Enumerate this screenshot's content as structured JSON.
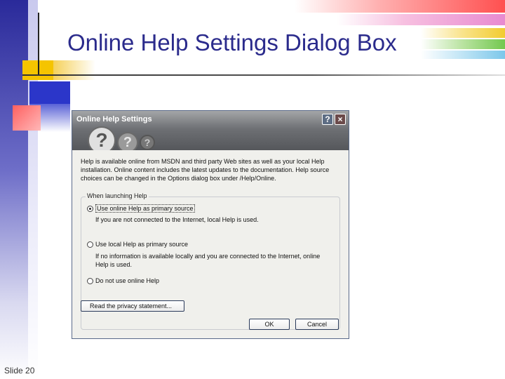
{
  "slide": {
    "title": "Online Help Settings Dialog Box",
    "slide_number": "Slide 20"
  },
  "dialog": {
    "title": "Online Help Settings",
    "help_button": "?",
    "close_button": "×",
    "intro_text": "Help is available online from MSDN and third party Web sites as well as your local Help installation. Online content includes the latest updates to the documentation. Help source choices can be changed in the Options dialog box under /Help/Online.",
    "group_label": "When launching Help",
    "options": [
      {
        "label": "Use online Help as primary source",
        "selected": true,
        "description": "If you are not connected to the Internet, local Help is used."
      },
      {
        "label": "Use local Help as primary source",
        "selected": false,
        "description": "If no information is available locally and you are connected to the Internet, online Help is used."
      },
      {
        "label": "Do not use online Help",
        "selected": false,
        "description": ""
      }
    ],
    "privacy_button": "Read the privacy statement...",
    "ok_button": "OK",
    "cancel_button": "Cancel"
  },
  "colors": {
    "title_color": "#2b2b8c",
    "band_blue": "#2a2a9a",
    "accent_yellow": "#f5c400",
    "accent_red": "#ff6060"
  }
}
